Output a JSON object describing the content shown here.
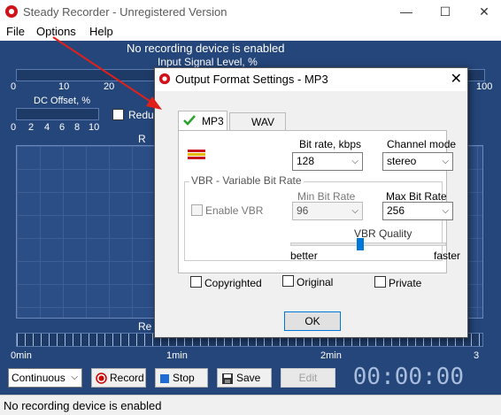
{
  "window": {
    "title": "Steady Recorder - Unregistered Version",
    "controls": [
      "—",
      "☐",
      "✕"
    ]
  },
  "menu": [
    "File",
    "Options",
    "Help"
  ],
  "main": {
    "device_message": "No recording device is enabled",
    "input_level_label": "Input Signal Level, %",
    "input_scale": [
      "0",
      "10",
      "20",
      "100"
    ],
    "dc_offset_label": "DC Offset, %",
    "dc_scale": [
      "0",
      "2",
      "4",
      "6",
      "8",
      "10"
    ],
    "reduce_label": "Reduc",
    "r_label_1": "R",
    "r_label_2": "Re",
    "time_scale": [
      "0min",
      "1min",
      "2min",
      "3"
    ]
  },
  "controls": {
    "mode_value": "Continuous",
    "record_label": "Record",
    "stop_label": "Stop",
    "save_label": "Save",
    "edit_label": "Edit",
    "timer": "00:00:00"
  },
  "status": {
    "text": "No recording device is enabled"
  },
  "dialog": {
    "title": "Output Format Settings - MP3",
    "tabs": [
      "MP3",
      "WAV"
    ],
    "bitrate_label": "Bit rate, kbps",
    "bitrate_value": "128",
    "channel_label": "Channel mode",
    "channel_value": "stereo",
    "vbr_group_label": "VBR - Variable Bit Rate",
    "enable_vbr_label": "Enable VBR",
    "min_bitrate_label": "Min Bit Rate",
    "min_bitrate_value": "96",
    "max_bitrate_label": "Max Bit Rate",
    "max_bitrate_value": "256",
    "vbr_quality_label": "VBR Quality",
    "vbr_quality_level": 0.45,
    "better_label": "better",
    "faster_label": "faster",
    "copyrighted_label": "Copyrighted",
    "original_label": "Original",
    "private_label": "Private",
    "ok_label": "OK"
  },
  "colors": {
    "accent": "#0078d7",
    "panel": "#25467a",
    "close_red": "#e81123",
    "check_green": "#2aa12a"
  }
}
